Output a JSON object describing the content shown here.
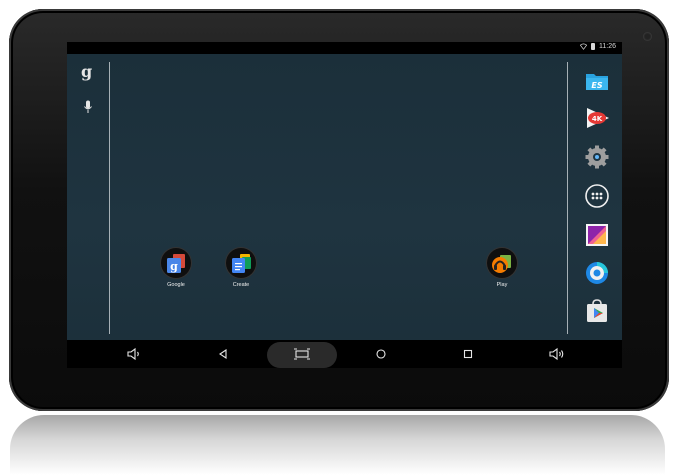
{
  "statusbar": {
    "time": "11:26"
  },
  "search": {
    "google_glyph": "g",
    "icons": [
      "google-search-icon",
      "microphone-icon"
    ]
  },
  "home_icons": [
    {
      "label": "Google",
      "icon": "google-folder-icon"
    },
    {
      "label": "Create",
      "icon": "create-folder-icon"
    },
    {
      "label": "Play",
      "icon": "play-folder-icon"
    }
  ],
  "dock": [
    "es-file-explorer-icon",
    "4k-player-icon",
    "settings-icon",
    "app-drawer-icon",
    "gallery-icon",
    "browser-icon",
    "play-store-icon"
  ],
  "navbar": [
    "volume-down-icon",
    "back-icon",
    "screenshot-icon",
    "home-icon",
    "recents-icon",
    "volume-up-icon"
  ],
  "colors": {
    "wallpaper": "#1f3440",
    "bar": "#000000",
    "accent_green": "#4fc3a1"
  }
}
